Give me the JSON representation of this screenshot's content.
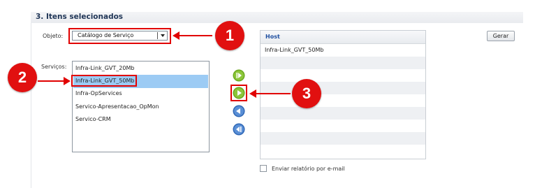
{
  "section": {
    "title": "3. Itens selecionados"
  },
  "objeto": {
    "label": "Objeto:",
    "selected": "Catálogo de Serviço"
  },
  "servicos": {
    "label": "Serviços:",
    "items": [
      {
        "label": "Infra-Link_GVT_20Mb",
        "selected": false
      },
      {
        "label": "Infra-Link_GVT_50Mb",
        "selected": true
      },
      {
        "label": "Infra-OpServices",
        "selected": false
      },
      {
        "label": "Servico-Apresentacao_OpMon",
        "selected": false
      },
      {
        "label": "Servico-CRM",
        "selected": false
      }
    ]
  },
  "host_table": {
    "header": "Host",
    "rows": [
      "Infra-Link_GVT_50Mb",
      "",
      "",
      "",
      "",
      "",
      "",
      "",
      "",
      ""
    ]
  },
  "buttons": {
    "gerar": "Gerar"
  },
  "email_checkbox": {
    "label": "Enviar relatório por e-mail",
    "checked": false
  },
  "callouts": [
    "1",
    "2",
    "3"
  ],
  "transfer_buttons": [
    "add-all-icon",
    "add-selected-icon",
    "remove-selected-icon",
    "remove-all-icon"
  ],
  "colors": {
    "accent_red": "#e10000",
    "selection_blue": "#9ccbf4",
    "green": "#6aa81e",
    "blue": "#2f67b5"
  }
}
